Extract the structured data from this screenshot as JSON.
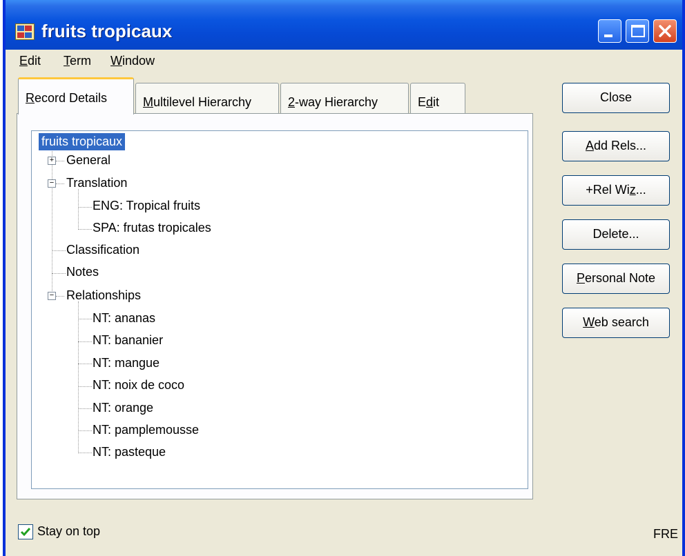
{
  "window": {
    "title": "fruits tropicaux"
  },
  "menu": [
    {
      "prefix": "",
      "key": "E",
      "rest": "dit"
    },
    {
      "prefix": "",
      "key": "T",
      "rest": "erm"
    },
    {
      "prefix": "",
      "key": "W",
      "rest": "indow"
    }
  ],
  "tabs": [
    {
      "prefix": "",
      "key": "R",
      "rest": "ecord Details"
    },
    {
      "prefix": "",
      "key": "M",
      "rest": "ultilevel Hierarchy"
    },
    {
      "prefix": "",
      "key": "2",
      "rest": "-way Hierarchy"
    },
    {
      "prefix": "E",
      "key": "d",
      "rest": "it"
    }
  ],
  "tree": {
    "root": "fruits tropicaux",
    "general": "General",
    "translation": "Translation",
    "translations": [
      "ENG: Tropical fruits",
      "SPA: frutas tropicales"
    ],
    "classification": "Classification",
    "notes": "Notes",
    "relationships": "Relationships",
    "relations": [
      "NT: ananas",
      "NT: bananier",
      "NT: mangue",
      "NT: noix de coco",
      "NT: orange",
      "NT: pamplemousse",
      "NT: pasteque"
    ]
  },
  "buttons": {
    "close": {
      "prefix": "Close",
      "key": "",
      "rest": ""
    },
    "add_rels": {
      "prefix": "",
      "key": "A",
      "rest": "dd Rels..."
    },
    "rel_wiz": {
      "prefix": "+Rel Wi",
      "key": "z",
      "rest": "..."
    },
    "delete": {
      "prefix": "Delete...",
      "key": "",
      "rest": ""
    },
    "personal_note": {
      "prefix": "",
      "key": "P",
      "rest": "ersonal Note"
    },
    "web_search": {
      "prefix": "",
      "key": "W",
      "rest": "eb search"
    }
  },
  "status": {
    "stay_on_top": "Stay on top",
    "stay_on_top_checked": true,
    "language": "FRE"
  },
  "colors": {
    "titlebar": "#0649d4",
    "selection": "#316ac5",
    "tab_highlight": "#ffc83c"
  }
}
